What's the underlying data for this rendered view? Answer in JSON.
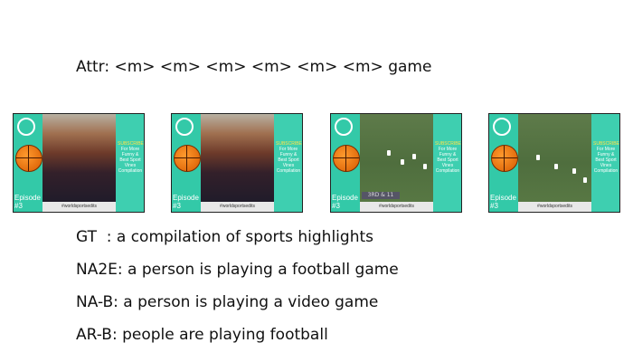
{
  "attr": "Attr: <m> <m> <m> <m> <m> <m> game",
  "frames": [
    {
      "type": "court",
      "episode": "Episode\n#3",
      "caption": "#worldsportsedits",
      "side_title": "SUBSCRIBE",
      "side_body": "For More Funny & Best Sport Vines Compilation"
    },
    {
      "type": "court",
      "episode": "Episode\n#3",
      "caption": "#worldsportsedits",
      "side_title": "SUBSCRIBE",
      "side_body": "For More Funny & Best Sport Vines Compilation"
    },
    {
      "type": "field",
      "episode": "Episode\n#3",
      "caption": "#worldsportsedits",
      "side_title": "SUBSCRIBE",
      "side_body": "For More Funny & Best Sport Vines Compilation",
      "score": "3RD & 11"
    },
    {
      "type": "field",
      "episode": "Episode\n#3",
      "caption": "#worldsportsedits",
      "side_title": "SUBSCRIBE",
      "side_body": "For More Funny & Best Sport Vines Compilation"
    }
  ],
  "gt": "GT  : a compilation of sports highlights",
  "na2e": "NA2E: a person is playing a football game",
  "nab": "NA-B: a person is playing a video game",
  "arb": "AR-B: people are playing football"
}
